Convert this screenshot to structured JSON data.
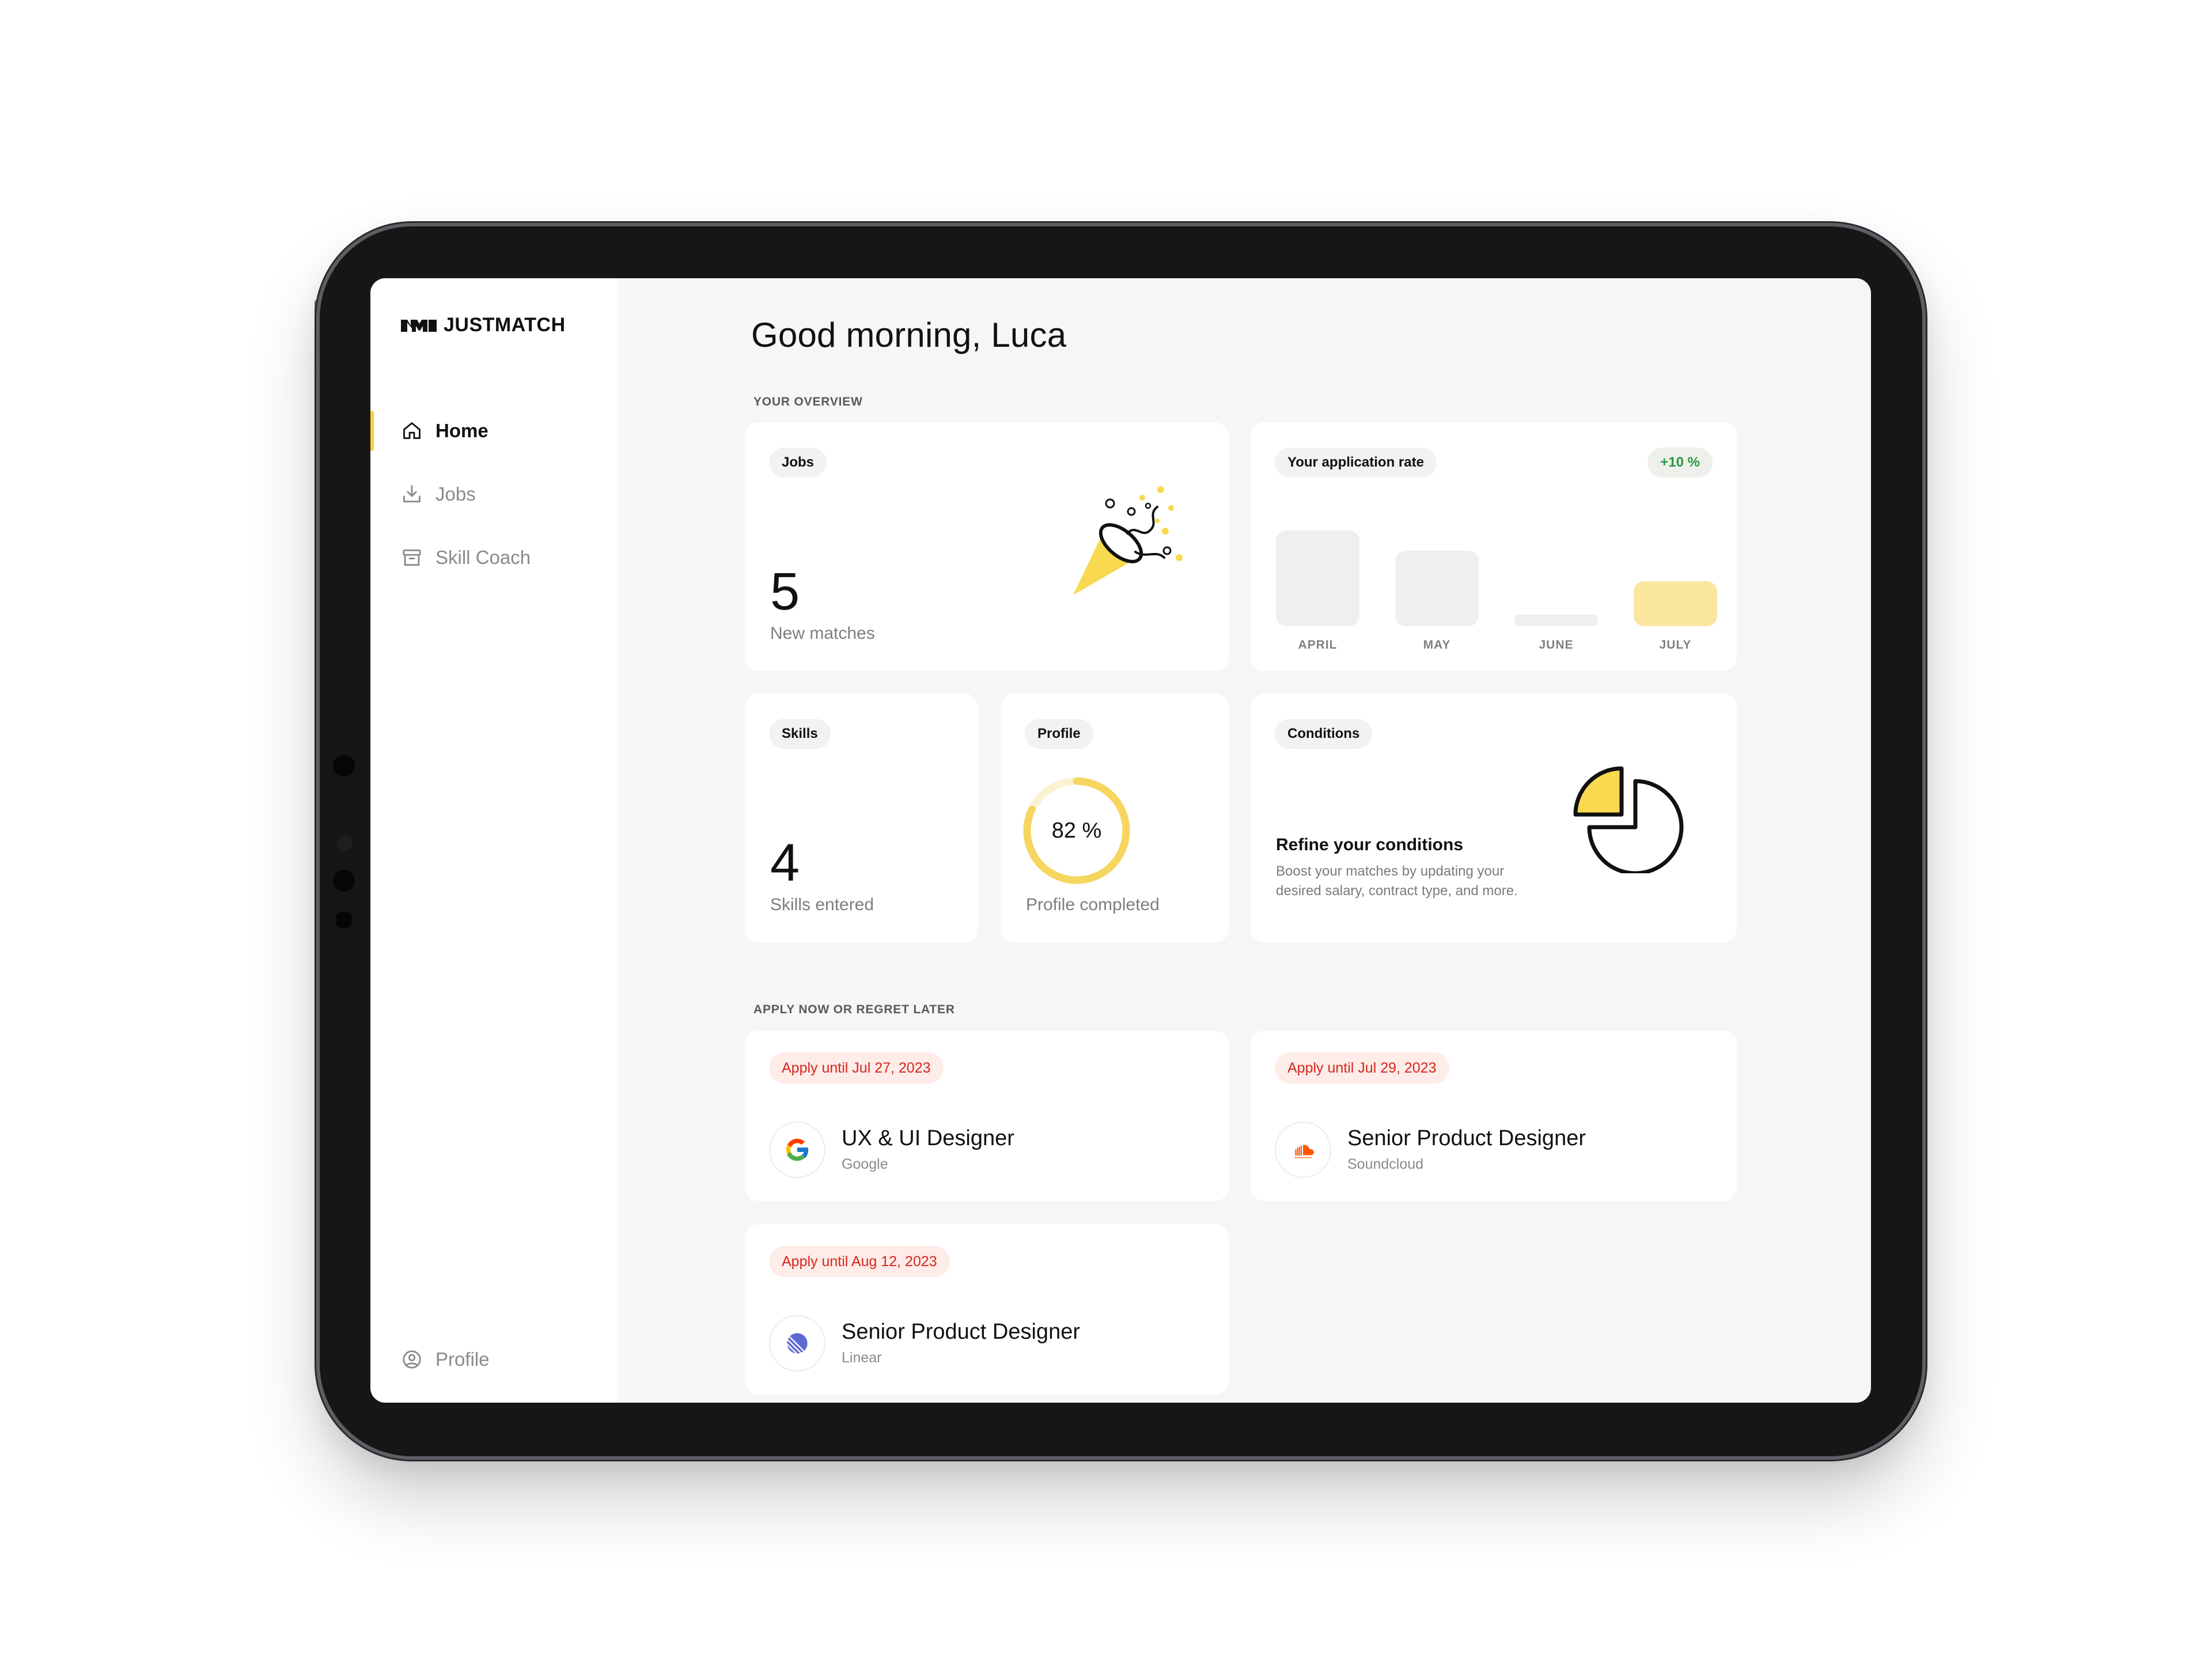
{
  "app": {
    "brand": "JUSTMATCH",
    "colors": {
      "accent": "#f6cf45",
      "accent_light": "#fbe6a0",
      "positive": "#2a9a43",
      "deadline": "#d7261e"
    }
  },
  "sidebar": {
    "items": [
      {
        "label": "Home",
        "icon": "home-icon",
        "active": true
      },
      {
        "label": "Jobs",
        "icon": "download-tray-icon",
        "active": false
      },
      {
        "label": "Skill Coach",
        "icon": "archive-box-icon",
        "active": false
      }
    ],
    "profile": {
      "label": "Profile",
      "icon": "user-circle-icon"
    }
  },
  "main": {
    "greeting": "Good morning, Luca",
    "overview_label": "YOUR OVERVIEW",
    "jobs_card": {
      "chip": "Jobs",
      "value": "5",
      "caption": "New matches"
    },
    "rate_card": {
      "chip": "Your application rate",
      "change": "+10 %",
      "chart_data": {
        "type": "bar",
        "categories": [
          "APRIL",
          "MAY",
          "JUNE",
          "JULY"
        ],
        "values": [
          66,
          52,
          8,
          31
        ],
        "highlight": "JULY"
      }
    },
    "skills_card": {
      "chip": "Skills",
      "value": "4",
      "caption": "Skills entered"
    },
    "profile_card": {
      "chip": "Profile",
      "percent": 82,
      "percent_text": "82 %",
      "caption": "Profile completed"
    },
    "conditions_card": {
      "chip": "Conditions",
      "title": "Refine your conditions",
      "description": "Boost your matches by updating your desired salary, contract type, and more."
    },
    "apply_label": "APPLY NOW OR REGRET LATER",
    "jobs": [
      {
        "deadline": "Apply until Jul 27, 2023",
        "title": "UX & UI Designer",
        "company": "Google",
        "logo": "google-logo-icon"
      },
      {
        "deadline": "Apply until Jul 29, 2023",
        "title": "Senior Product Designer",
        "company": "Soundcloud",
        "logo": "soundcloud-logo-icon"
      },
      {
        "deadline": "Apply until Aug 12, 2023",
        "title": "Senior Product Designer",
        "company": "Linear",
        "logo": "linear-logo-icon"
      }
    ]
  }
}
